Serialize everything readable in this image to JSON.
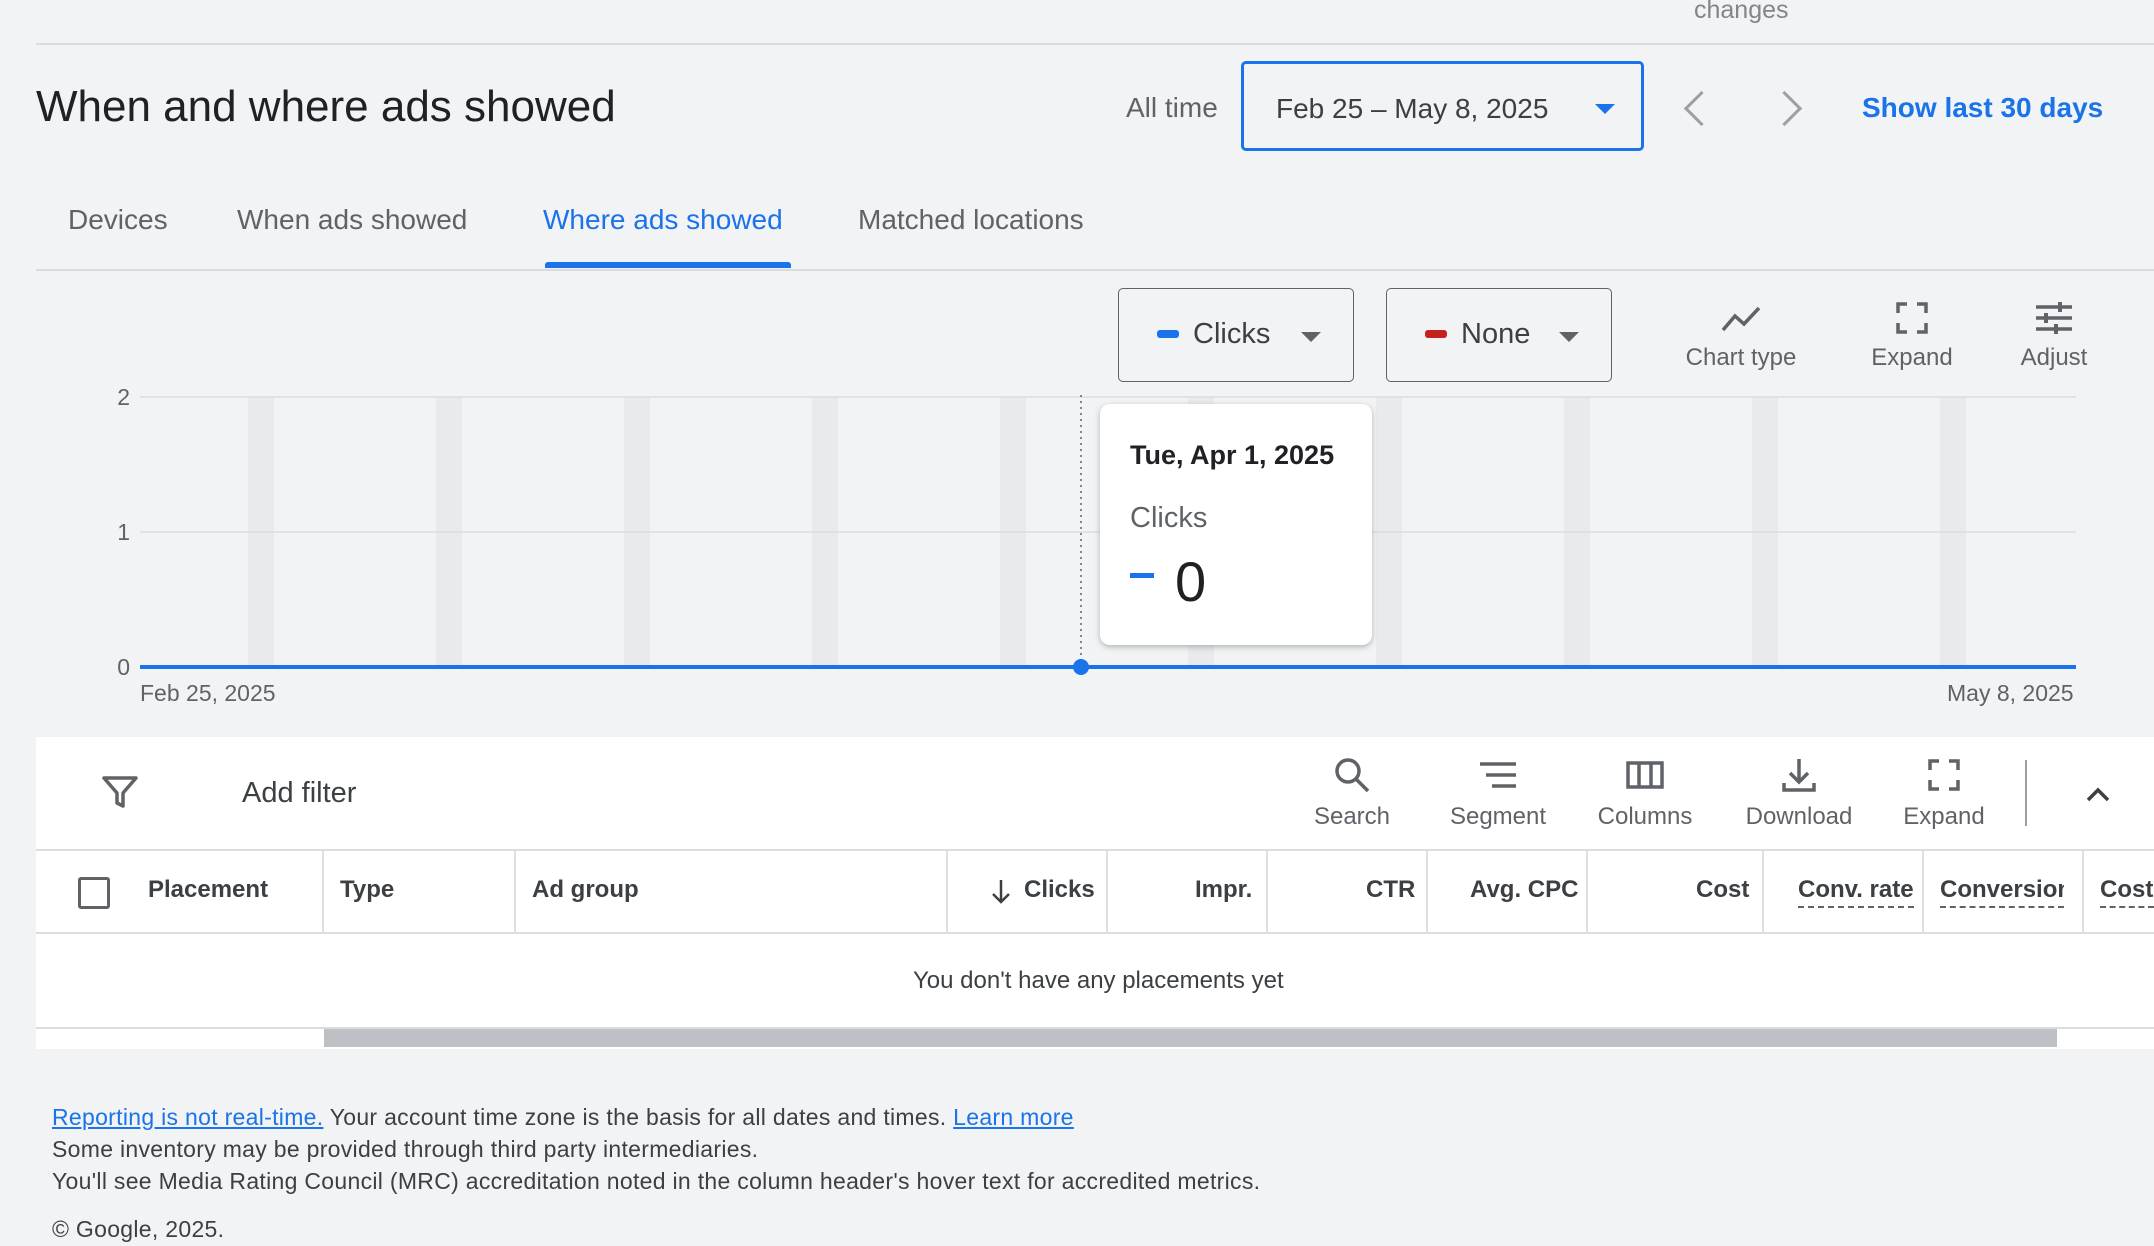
{
  "top": {
    "cut_label": "changes"
  },
  "header": {
    "title": "When and where ads showed",
    "range_label": "All time",
    "date_range": "Feb 25 – May 8, 2025",
    "show_last": "Show last 30 days"
  },
  "tabs": [
    {
      "label": "Devices",
      "active": false
    },
    {
      "label": "When ads showed",
      "active": false
    },
    {
      "label": "Where ads showed",
      "active": true
    },
    {
      "label": "Matched locations",
      "active": false
    }
  ],
  "chart_controls": {
    "metric1": {
      "label": "Clicks",
      "color": "#1a73e8"
    },
    "metric2": {
      "label": "None",
      "color": "#c5221f"
    },
    "tools": [
      {
        "label": "Chart type",
        "icon": "chart-line-icon"
      },
      {
        "label": "Expand",
        "icon": "expand-icon"
      },
      {
        "label": "Adjust",
        "icon": "tune-icon"
      }
    ]
  },
  "chart_data": {
    "type": "line",
    "series": [
      {
        "name": "Clicks",
        "color": "#1a73e8",
        "values": [
          0,
          0
        ]
      }
    ],
    "x": [
      "Feb 25, 2025",
      "May 8, 2025"
    ],
    "x_tick_labels": [
      "Feb 25, 2025",
      "May 8, 2025"
    ],
    "y_ticks": [
      "0",
      "1",
      "2"
    ],
    "ylim": [
      0,
      2
    ],
    "grid": true,
    "highlight": {
      "date": "Tue, Apr 1, 2025",
      "metric": "Clicks",
      "value": "0"
    }
  },
  "table_toolbar": {
    "add_filter": "Add filter",
    "tools": [
      {
        "label": "Search",
        "icon": "search-icon"
      },
      {
        "label": "Segment",
        "icon": "segment-icon"
      },
      {
        "label": "Columns",
        "icon": "columns-icon"
      },
      {
        "label": "Download",
        "icon": "download-icon"
      },
      {
        "label": "Expand",
        "icon": "expand-icon"
      }
    ]
  },
  "table": {
    "columns": [
      "Placement",
      "Type",
      "Ad group",
      "Clicks",
      "Impr.",
      "CTR",
      "Avg. CPC",
      "Cost",
      "Conv. rate",
      "Conversions",
      "Cost"
    ],
    "empty_message": "You don't have any placements yet"
  },
  "footer": {
    "reporting_link": "Reporting is not real-time.",
    "timezone_text": " Your account time zone is the basis for all dates and times. ",
    "learn_more": "Learn more",
    "line2": "Some inventory may be provided through third party intermediaries.",
    "line3": "You'll see Media Rating Council (MRC) accreditation noted in the column header's hover text for accredited metrics.",
    "copyright": "© Google, 2025."
  }
}
